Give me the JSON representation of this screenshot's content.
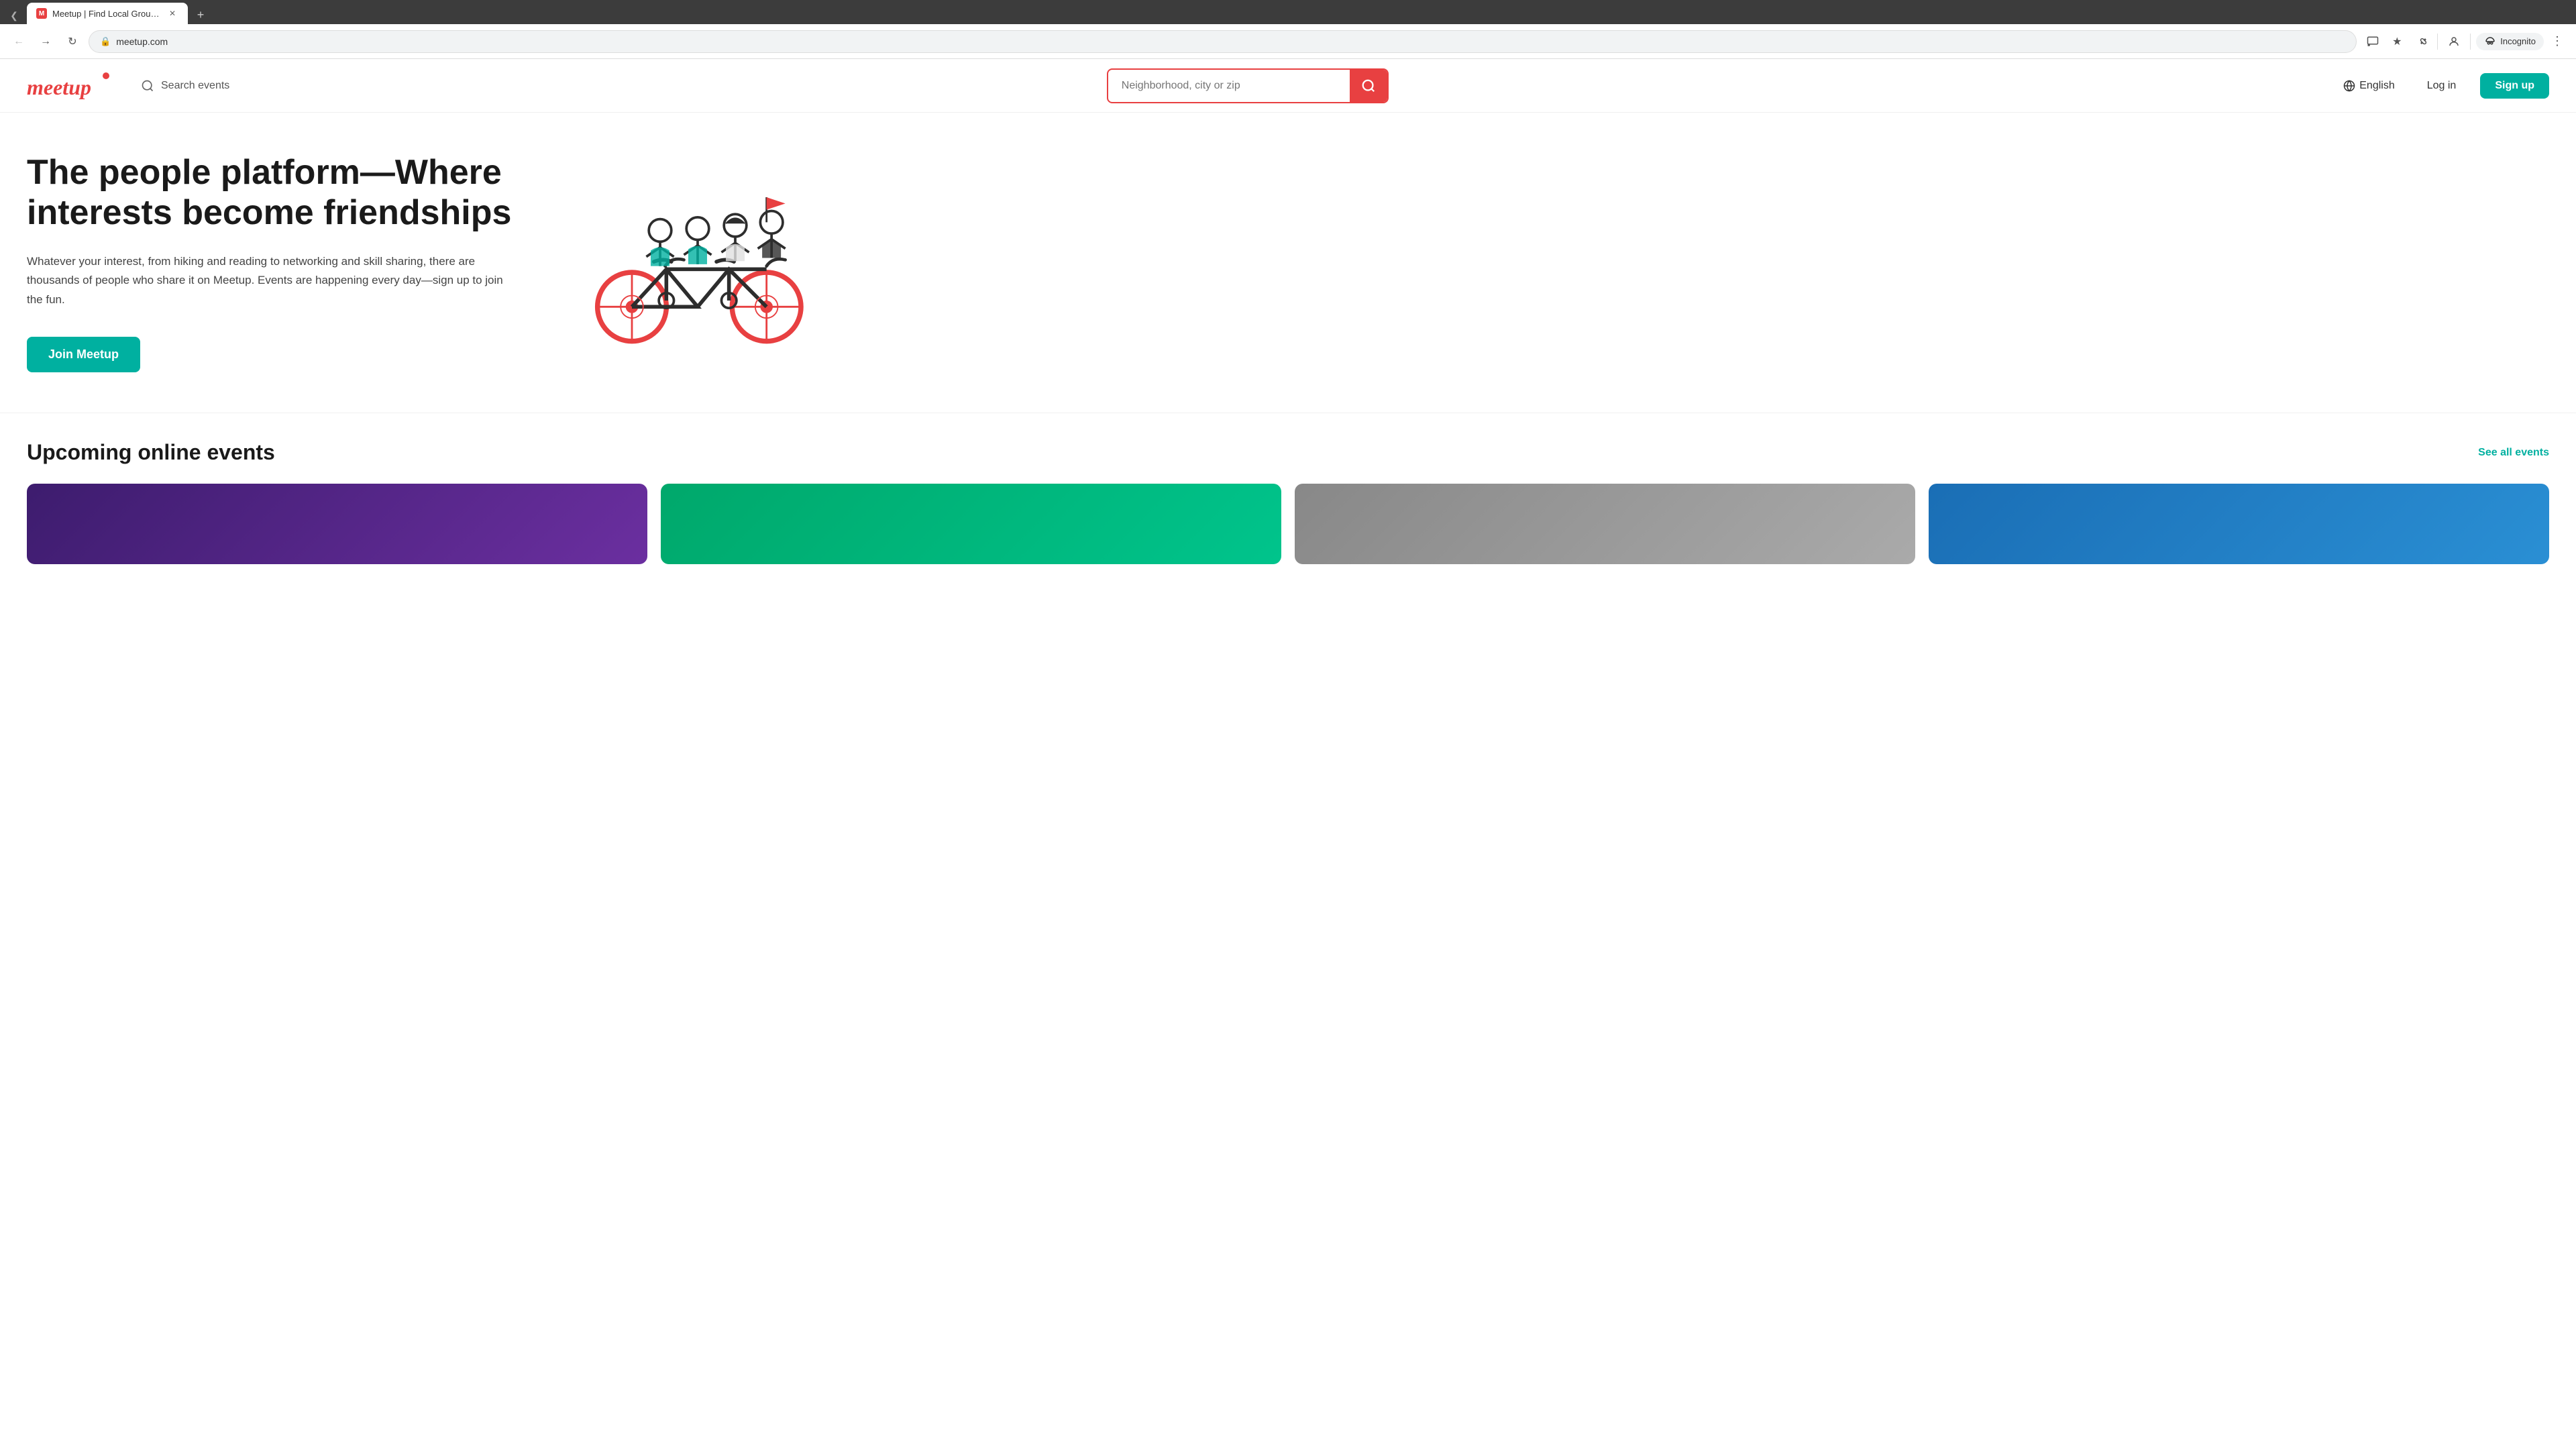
{
  "browser": {
    "tabs": [
      {
        "id": "tab1",
        "title": "Meetup | Find Local Groups, Ev...",
        "url": "meetup.com",
        "active": true,
        "favicon": "M"
      }
    ],
    "new_tab_label": "+",
    "nav": {
      "back_title": "Back",
      "forward_title": "Forward",
      "refresh_title": "Refresh",
      "address": "meetup.com"
    },
    "actions": {
      "cast_title": "Cast",
      "bookmark_title": "Bookmark",
      "extensions_title": "Extensions",
      "profile_title": "Browser Profile",
      "incognito_label": "Incognito",
      "menu_title": "Menu"
    }
  },
  "site": {
    "logo": {
      "text": "meetup",
      "alt": "Meetup"
    },
    "header": {
      "search_events_label": "Search events",
      "location_placeholder": "Neighborhood, city or zip",
      "language_label": "English",
      "login_label": "Log in",
      "signup_label": "Sign up"
    },
    "hero": {
      "title": "The people platform—Where interests become friendships",
      "description": "Whatever your interest, from hiking and reading to networking and skill sharing, there are thousands of people who share it on Meetup. Events are happening every day—sign up to join the fun.",
      "join_label": "Join Meetup"
    },
    "upcoming": {
      "title": "Upcoming online events",
      "see_all_label": "See all events"
    }
  }
}
